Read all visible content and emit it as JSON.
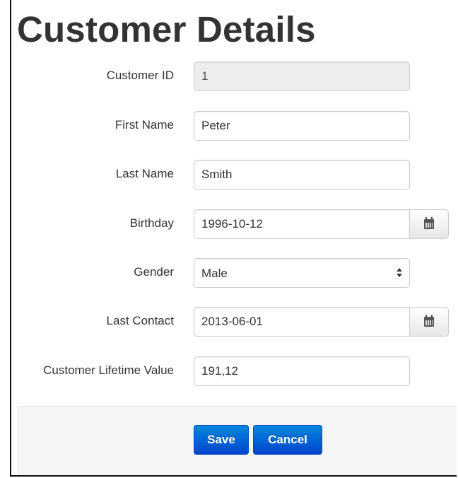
{
  "page": {
    "title": "Customer Details"
  },
  "form": {
    "customer_id": {
      "label": "Customer ID",
      "value": "1"
    },
    "first_name": {
      "label": "First Name",
      "value": "Peter"
    },
    "last_name": {
      "label": "Last Name",
      "value": "Smith"
    },
    "birthday": {
      "label": "Birthday",
      "value": "1996-10-12",
      "icon": "calendar-icon"
    },
    "gender": {
      "label": "Gender",
      "value": "Male",
      "icon": "updown-arrows-icon"
    },
    "last_contact": {
      "label": "Last Contact",
      "value": "2013-06-01",
      "icon": "calendar-icon"
    },
    "lifetime_value": {
      "label": "Customer Lifetime Value",
      "value": "191,12"
    }
  },
  "actions": {
    "save_label": "Save",
    "cancel_label": "Cancel"
  },
  "colors": {
    "primary": "#0055cc",
    "actions_background": "#f5f5f5",
    "readonly_background": "#eeeeee"
  }
}
